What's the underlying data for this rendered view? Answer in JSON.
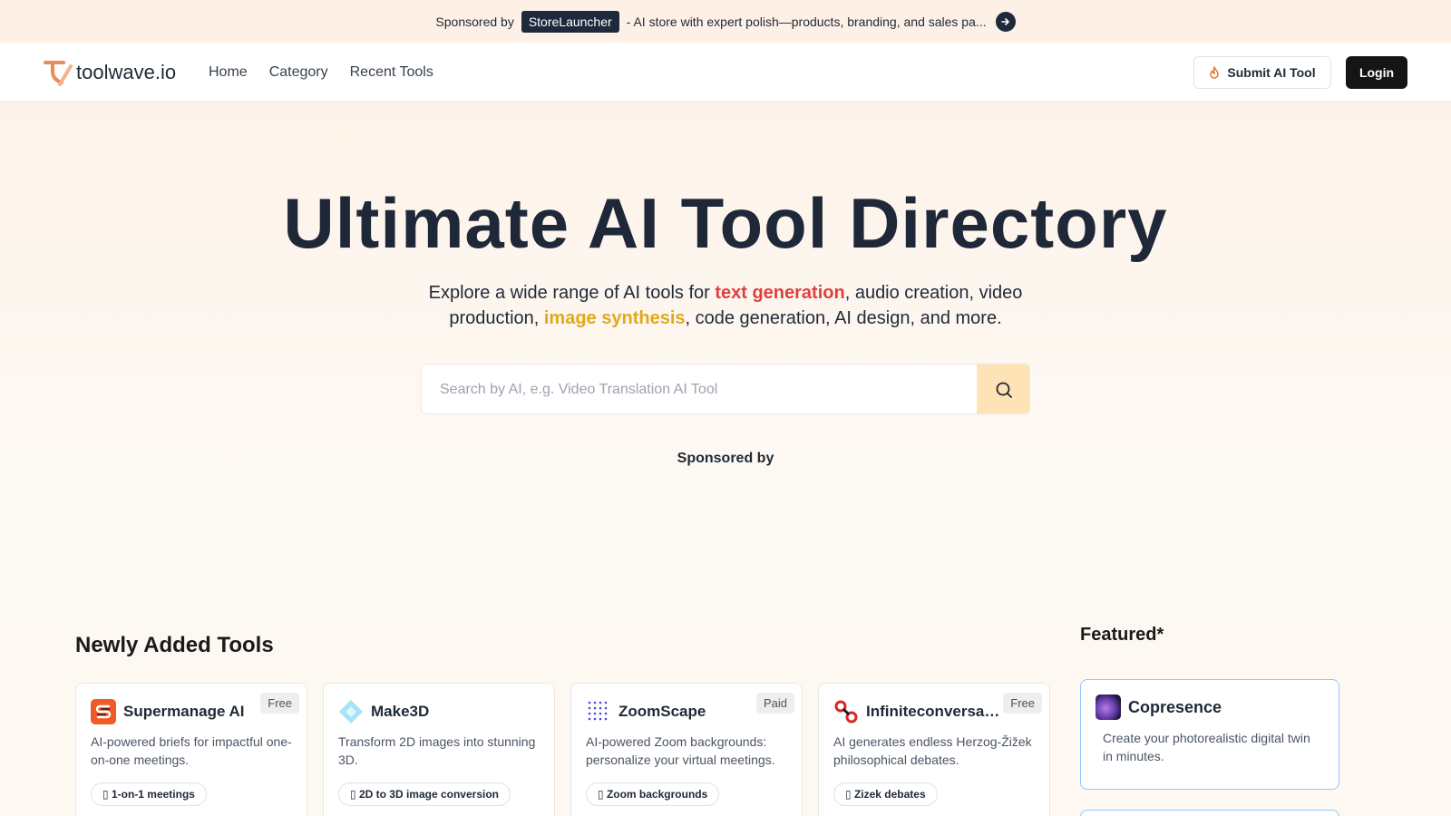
{
  "banner": {
    "sponsored_label": "Sponsored by",
    "brand": "StoreLauncher",
    "promo_text": "- AI store with expert polish—products, branding, and sales pa...",
    "arrow_icon": "arrow-right-icon"
  },
  "nav": {
    "logo_text": "toolwave.io",
    "links": [
      "Home",
      "Category",
      "Recent Tools"
    ],
    "submit_label": "Submit AI Tool",
    "submit_icon": "flame-icon",
    "login_label": "Login"
  },
  "hero": {
    "title": "Ultimate AI Tool Directory",
    "subtitle_part1": "Explore a wide range of AI tools for ",
    "subtitle_hl1": "text generation",
    "subtitle_part2": ", audio creation, video production, ",
    "subtitle_hl2": "image synthesis",
    "subtitle_part3": ", code generation, AI design, and more.",
    "search_placeholder": "Search by AI, e.g. Video Translation AI Tool",
    "search_icon": "search-icon",
    "sponsored_label": "Sponsored by"
  },
  "newly_added": {
    "title": "Newly Added Tools",
    "tools": [
      {
        "name": "Supermanage AI",
        "badge": "Free",
        "desc": "AI-powered briefs for impactful one-on-one meetings.",
        "tag": "▯ 1-on-1 meetings",
        "icon_color": "#f05a28"
      },
      {
        "name": "Make3D",
        "badge": "",
        "desc": "Transform 2D images into stunning 3D.",
        "tag": "▯ 2D to 3D image conversion",
        "icon_color": "#7dd3fc"
      },
      {
        "name": "ZoomScape",
        "badge": "Paid",
        "desc": "AI-powered Zoom backgrounds: personalize your virtual meetings.",
        "tag": "▯ Zoom backgrounds",
        "icon_color": "#4f46e5"
      },
      {
        "name": "Infiniteconversat...",
        "badge": "Free",
        "desc": "AI generates endless Herzog-Žižek philosophical debates.",
        "tag": "▯ Zizek debates",
        "icon_color": "#dc2626"
      }
    ]
  },
  "featured": {
    "title": "Featured*",
    "items": [
      {
        "name": "Copresence",
        "desc": "Create your photorealistic digital twin in minutes."
      }
    ]
  },
  "colors": {
    "accent_red": "#e23d3d",
    "accent_yellow": "#e0a91b",
    "dark": "#1e2838",
    "search_button": "#fde3b6"
  }
}
